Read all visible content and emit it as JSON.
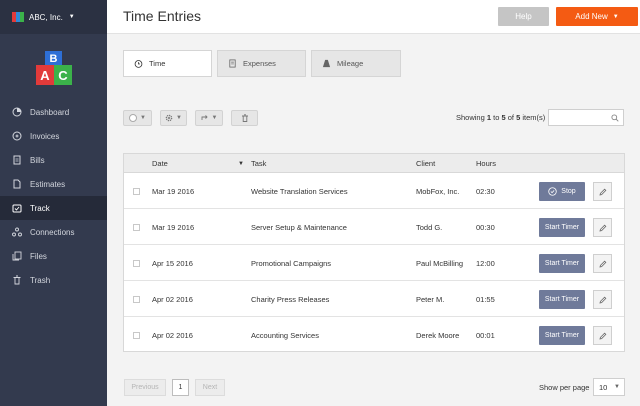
{
  "org": {
    "name": "ABC, Inc.",
    "caret": "▼"
  },
  "brand_colors": {
    "sidebar": "#333a4e",
    "accent": "#f45b13",
    "button": "#6f7a9a"
  },
  "sidebar": {
    "items": [
      {
        "label": "Dashboard",
        "icon": "dashboard-icon"
      },
      {
        "label": "Invoices",
        "icon": "invoices-icon"
      },
      {
        "label": "Bills",
        "icon": "bills-icon"
      },
      {
        "label": "Estimates",
        "icon": "estimates-icon"
      },
      {
        "label": "Track",
        "icon": "track-icon",
        "active": true
      },
      {
        "label": "Connections",
        "icon": "connections-icon"
      },
      {
        "label": "Files",
        "icon": "files-icon"
      },
      {
        "label": "Trash",
        "icon": "trash-icon"
      }
    ]
  },
  "header": {
    "title": "Time Entries",
    "help_label": "Help",
    "add_new_label": "Add New",
    "add_new_caret": "▼"
  },
  "tabs": [
    {
      "label": "Time",
      "icon": "clock-icon",
      "active": true
    },
    {
      "label": "Expenses",
      "icon": "expenses-icon"
    },
    {
      "label": "Mileage",
      "icon": "road-icon"
    }
  ],
  "toolbar": {
    "caret": "▼",
    "showing_prefix": "Showing ",
    "showing_from": "1",
    "showing_to_word": " to ",
    "showing_to": "5",
    "showing_of_word": " of ",
    "showing_total": "5",
    "showing_suffix": " item(s)",
    "search_placeholder": ""
  },
  "table": {
    "headers": {
      "date": "Date",
      "sort": "▼",
      "task": "Task",
      "client": "Client",
      "hours": "Hours"
    },
    "rows": [
      {
        "date": "Mar 19 2016",
        "task": "Website Translation Services",
        "client": "MobFox, Inc.",
        "hours": "02:30",
        "action": "Stop"
      },
      {
        "date": "Mar 19 2016",
        "task": "Server Setup & Maintenance",
        "client": "Todd G.",
        "hours": "00:30",
        "action": "Start Timer"
      },
      {
        "date": "Apr 15 2016",
        "task": "Promotional Campaigns",
        "client": "Paul McBilling",
        "hours": "12:00",
        "action": "Start Timer"
      },
      {
        "date": "Apr 02 2016",
        "task": "Charity Press Releases",
        "client": "Peter M.",
        "hours": "01:55",
        "action": "Start Timer"
      },
      {
        "date": "Apr 02 2016",
        "task": "Accounting Services",
        "client": "Derek Moore",
        "hours": "00:01",
        "action": "Start Timer"
      }
    ]
  },
  "pagination": {
    "previous": "Previous",
    "current": "1",
    "next": "Next",
    "per_page_label": "Show per page",
    "per_page_value": "10",
    "caret": "▼"
  }
}
